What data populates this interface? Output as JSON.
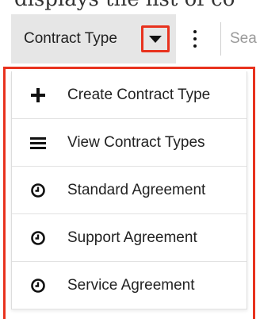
{
  "caption": "displays the list of co",
  "navbar": {
    "module_label": "Contract Type",
    "search_placeholder": "Sea"
  },
  "menu": {
    "items": [
      {
        "label": "Create Contract Type",
        "icon": "plus-icon"
      },
      {
        "label": "View Contract Types",
        "icon": "list-icon"
      },
      {
        "label": "Standard Agreement",
        "icon": "clock-icon"
      },
      {
        "label": "Support Agreement",
        "icon": "clock-icon"
      },
      {
        "label": "Service Agreement",
        "icon": "clock-icon"
      }
    ]
  },
  "colors": {
    "highlight": "#e8321e",
    "tab_background": "#e6e6e6"
  }
}
